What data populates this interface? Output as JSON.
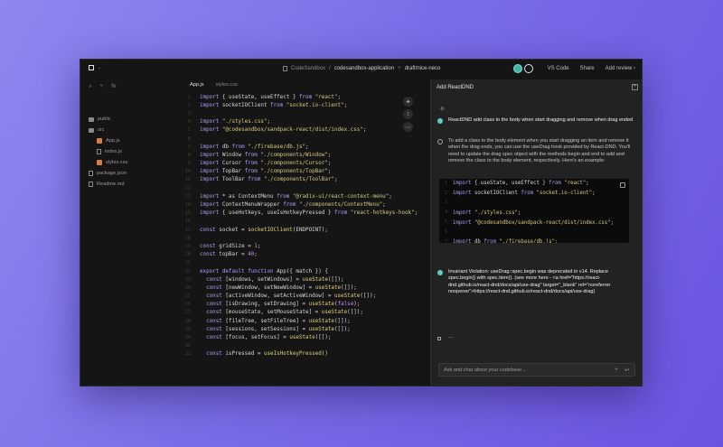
{
  "titlebar": {
    "breadcrumb_org": "CodeSandbox",
    "breadcrumb_sep": "/",
    "breadcrumb_repo": "codesandbox-application",
    "branch": "draft/nice-neco",
    "vscode_label": "VS Code",
    "share_label": "Share",
    "add_review_label": "Add review",
    "add_review_chevron": "›"
  },
  "files": [
    {
      "name": "public",
      "type": "folder",
      "depth": 0
    },
    {
      "name": "src",
      "type": "folder",
      "depth": 0
    },
    {
      "name": "App.js",
      "type": "js",
      "depth": 1
    },
    {
      "name": "index.js",
      "type": "file",
      "depth": 1
    },
    {
      "name": "styles.css",
      "type": "css",
      "depth": 1
    },
    {
      "name": "package.json",
      "type": "file",
      "depth": 0
    },
    {
      "name": "Readme.md",
      "type": "file",
      "depth": 0
    }
  ],
  "editor": {
    "tabs": [
      "App.js",
      "styles.css"
    ],
    "active_tab": "App.js"
  },
  "code_lines": [
    {
      "n": "1",
      "t": "import { useState, useEffect } from \"react\";"
    },
    {
      "n": "2",
      "t": "import socketIOClient from \"socket.io-client\";"
    },
    {
      "n": "3",
      "t": ""
    },
    {
      "n": "4",
      "t": "import \"./styles.css\";"
    },
    {
      "n": "5",
      "t": "import \"@codesandbox/sandpack-react/dist/index.css\";"
    },
    {
      "n": "6",
      "t": ""
    },
    {
      "n": "7",
      "t": "import db from \"./firebase/db.js\";"
    },
    {
      "n": "8",
      "t": "import Window from \"./components/Window\";"
    },
    {
      "n": "9",
      "t": "import Cursor from \"./components/Cursor\";"
    },
    {
      "n": "10",
      "t": "import TopBar from \"./components/TopBar\";"
    },
    {
      "n": "11",
      "t": "import ToolBar from \"./components/ToolBar\";"
    },
    {
      "n": "12",
      "t": ""
    },
    {
      "n": "13",
      "t": "import * as ContextMenu from \"@radix-ui/react-context-menu\";"
    },
    {
      "n": "14",
      "t": "import ContextMenuWrapper from \"./components/ContextMenu\";"
    },
    {
      "n": "15",
      "t": "import { useHotkeys, useIsHotkeyPressed } from \"react-hotkeys-hook\";"
    },
    {
      "n": "16",
      "t": ""
    },
    {
      "n": "17",
      "t": "const socket = socketIOClient(ENDPOINT);"
    },
    {
      "n": "18",
      "t": ""
    },
    {
      "n": "19",
      "t": "const gridSize = 1;"
    },
    {
      "n": "20",
      "t": "const topBar = 40;"
    },
    {
      "n": "21",
      "t": ""
    },
    {
      "n": "22",
      "t": "export default function App({ match }) {"
    },
    {
      "n": "23",
      "t": "  const [windows, setWindows] = useState([]);"
    },
    {
      "n": "24",
      "t": "  const [newWindow, setNewWindow] = useState([]);"
    },
    {
      "n": "25",
      "t": "  const [activeWindow, setActiveWindow] = useState([]);"
    },
    {
      "n": "26",
      "t": "  const [isDrawing, setDrawing] = useState(false);"
    },
    {
      "n": "27",
      "t": "  const [mouseState, setMouseState] = useState([]);"
    },
    {
      "n": "28",
      "t": "  const [fileTree, setFileTree] = useState([]);"
    },
    {
      "n": "29",
      "t": "  const [sessions, setSessions] = useState([]);"
    },
    {
      "n": "30",
      "t": "  const [focus, setFocus] = useState([]);"
    },
    {
      "n": "31",
      "t": ""
    },
    {
      "n": "32",
      "t": "  const isPressed = useIsHotkeyPressed()"
    }
  ],
  "panel": {
    "title": "Add ReactDND",
    "messages": [
      {
        "role": "user",
        "text": "ReactDND add class to the body when start dragging and remove when drag ended"
      },
      {
        "role": "assistant",
        "text": "To add a class to the body element when you start dragging an item and remove it when the drag ends, you can use the useDrag hook provided by React-DND. You'll need to update the drag spec object with the methods begin and end to add and remove the class to the body element, respectively. Here's an example:"
      },
      {
        "role": "user",
        "text": "Invariant Violation: useDrag::spec.begin was deprecated in v14. Replace spec.begin() with spec.item(). (see more here - <a href=\"https://react-dnd.github.io/react-dnd/docs/api/use-drag\" target=\"_blank\" rel=\"noreferrer noopener\">https://react-dnd.github.io/react-dnd/docs/api/use-drag)"
      },
      {
        "role": "assistant",
        "text": "..."
      }
    ],
    "snippet_lines": [
      {
        "n": "1",
        "t": "import { useState, useEffect } from \"react\";"
      },
      {
        "n": "2",
        "t": "import socketIOClient from \"socket.io-client\";"
      },
      {
        "n": "3",
        "t": ""
      },
      {
        "n": "4",
        "t": "import \"./styles.css\";"
      },
      {
        "n": "5",
        "t": "import \"@codesandbox/sandpack-react/dist/index.css\";"
      },
      {
        "n": "6",
        "t": ""
      },
      {
        "n": "7",
        "t": "import db from \"./firebase/db.js\";"
      },
      {
        "n": "8",
        "t": "import Window from \"./components/Window\";"
      },
      {
        "n": "9",
        "t": "import Cursor from \"./components/Cursor\";"
      }
    ],
    "chat_placeholder": "Ask and chat about your codebase..."
  },
  "colors": {
    "keyword": "#a6a1f7",
    "string": "#d7c97c",
    "function": "#e5d27a",
    "number": "#c98cf0",
    "accent_teal": "#5fd0c0",
    "background_purple": "#7a6ee8"
  }
}
